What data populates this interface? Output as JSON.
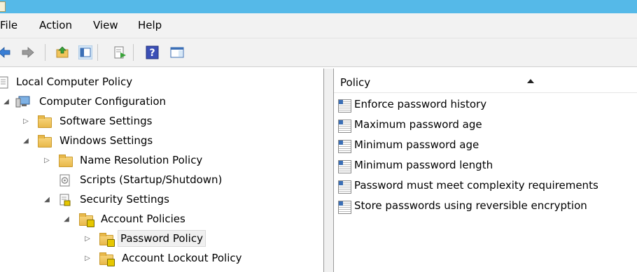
{
  "menu": [
    "File",
    "Action",
    "View",
    "Help"
  ],
  "toolbar": {
    "icons": [
      "back-arrow-icon",
      "forward-arrow-icon",
      "up-folder-icon",
      "show-hide-tree-icon",
      "export-list-icon",
      "help-icon",
      "properties-pane-icon"
    ]
  },
  "tree": {
    "root": "Local Computer Policy",
    "computer_configuration": "Computer Configuration",
    "software_settings": "Software Settings",
    "windows_settings": "Windows Settings",
    "name_resolution_policy": "Name Resolution Policy",
    "scripts": "Scripts (Startup/Shutdown)",
    "security_settings": "Security Settings",
    "account_policies": "Account Policies",
    "password_policy": "Password Policy",
    "account_lockout_policy": "Account Lockout Policy",
    "selected": "Password Policy"
  },
  "list": {
    "column_header": "Policy",
    "sorted": "ascending",
    "rows": [
      "Enforce password history",
      "Maximum password age",
      "Minimum password age",
      "Minimum password length",
      "Password must meet complexity requirements",
      "Store passwords using reversible encryption"
    ]
  }
}
